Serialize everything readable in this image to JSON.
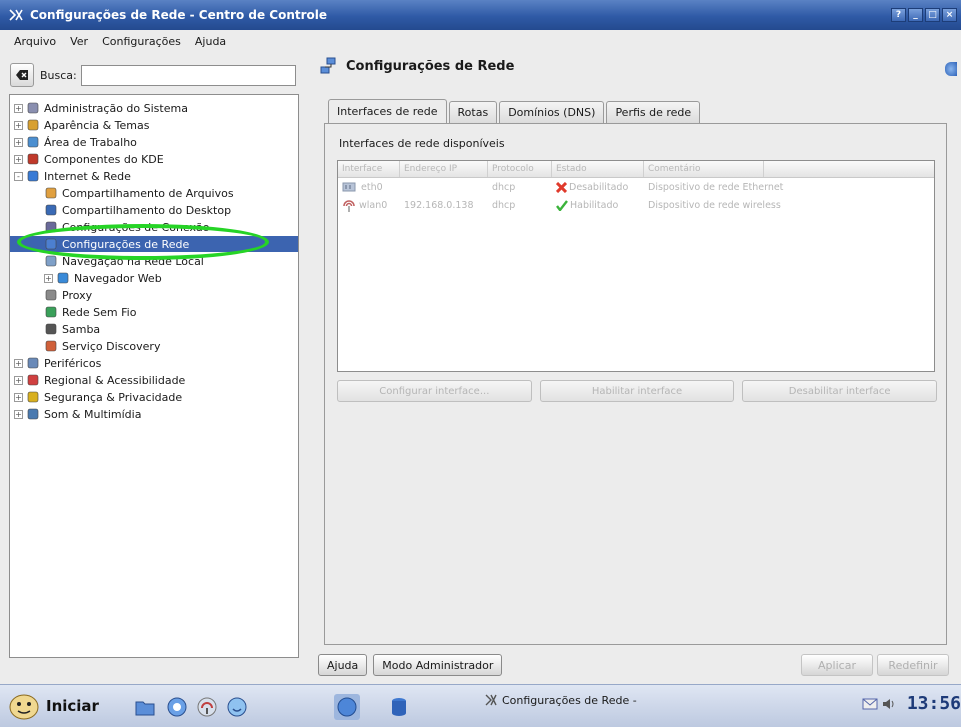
{
  "window": {
    "title": "Configurações de Rede - Centro de Controle",
    "buttons": [
      "?",
      "_",
      "□",
      "×"
    ]
  },
  "menubar": [
    "Arquivo",
    "Ver",
    "Configurações",
    "Ajuda"
  ],
  "search": {
    "label": "Busca:",
    "value": ""
  },
  "tree": [
    {
      "label": "Administração do Sistema",
      "expander": "+",
      "icon": "admin-icon",
      "indent": 0
    },
    {
      "label": "Aparência & Temas",
      "expander": "+",
      "icon": "appearance-icon",
      "indent": 0
    },
    {
      "label": "Área de Trabalho",
      "expander": "+",
      "icon": "desktop-icon",
      "indent": 0
    },
    {
      "label": "Componentes do KDE",
      "expander": "+",
      "icon": "kde-components-icon",
      "indent": 0
    },
    {
      "label": "Internet & Rede",
      "expander": "-",
      "icon": "internet-icon",
      "indent": 0
    },
    {
      "label": "Compartilhamento de Arquivos",
      "expander": "",
      "icon": "file-sharing-icon",
      "indent": 1
    },
    {
      "label": "Compartilhamento do Desktop",
      "expander": "",
      "icon": "desktop-sharing-icon",
      "indent": 1
    },
    {
      "label": "Configurações de Conexão",
      "expander": "",
      "icon": "connection-icon",
      "indent": 1
    },
    {
      "label": "Configurações de Rede",
      "expander": "",
      "icon": "network-icon",
      "indent": 1,
      "selected": true
    },
    {
      "label": "Navegação na Rede Local",
      "expander": "",
      "icon": "lan-browsing-icon",
      "indent": 1
    },
    {
      "label": "Navegador Web",
      "expander": "+",
      "icon": "web-browser-icon",
      "indent": 1
    },
    {
      "label": "Proxy",
      "expander": "",
      "icon": "proxy-icon",
      "indent": 1
    },
    {
      "label": "Rede Sem Fio",
      "expander": "",
      "icon": "wireless-icon",
      "indent": 1
    },
    {
      "label": "Samba",
      "expander": "",
      "icon": "samba-icon",
      "indent": 1
    },
    {
      "label": "Serviço Discovery",
      "expander": "",
      "icon": "discovery-icon",
      "indent": 1
    },
    {
      "label": "Periféricos",
      "expander": "+",
      "icon": "peripherals-icon",
      "indent": 0
    },
    {
      "label": "Regional & Acessibilidade",
      "expander": "+",
      "icon": "regional-icon",
      "indent": 0
    },
    {
      "label": "Segurança & Privacidade",
      "expander": "+",
      "icon": "security-icon",
      "indent": 0
    },
    {
      "label": "Som & Multimídia",
      "expander": "+",
      "icon": "sound-icon",
      "indent": 0
    }
  ],
  "page": {
    "title": "Configurações de Rede",
    "tabs": [
      "Interfaces de rede",
      "Rotas",
      "Domínios (DNS)",
      "Perfis de rede"
    ],
    "group_title": "Interfaces de rede disponíveis",
    "columns": [
      "Interface",
      "Endereço IP",
      "Protocolo",
      "Estado",
      "Comentário"
    ],
    "rows": [
      {
        "interface": "eth0",
        "ip": "",
        "protocol": "dhcp",
        "status": "Desabilitado",
        "status_icon": "disabled-x-icon",
        "comment": "Dispositivo de rede Ethernet"
      },
      {
        "interface": "wlan0",
        "ip": "192.168.0.138",
        "protocol": "dhcp",
        "status": "Habilitado",
        "status_icon": "enabled-check-icon",
        "comment": "Dispositivo de rede wireless"
      }
    ],
    "action_buttons": [
      "Configurar interface...",
      "Habilitar interface",
      "Desabilitar interface"
    ]
  },
  "footer": {
    "help": "Ajuda",
    "admin_mode": "Modo Administrador",
    "apply": "Aplicar",
    "reset": "Redefinir"
  },
  "taskbar": {
    "start_label": "Iniciar",
    "task_item": "Configurações de Rede -",
    "clock": "13:56"
  },
  "colors": {
    "selection": "#3c64b0",
    "titlebar": "#2f5aa6",
    "highlight_ellipse": "#26d426"
  }
}
